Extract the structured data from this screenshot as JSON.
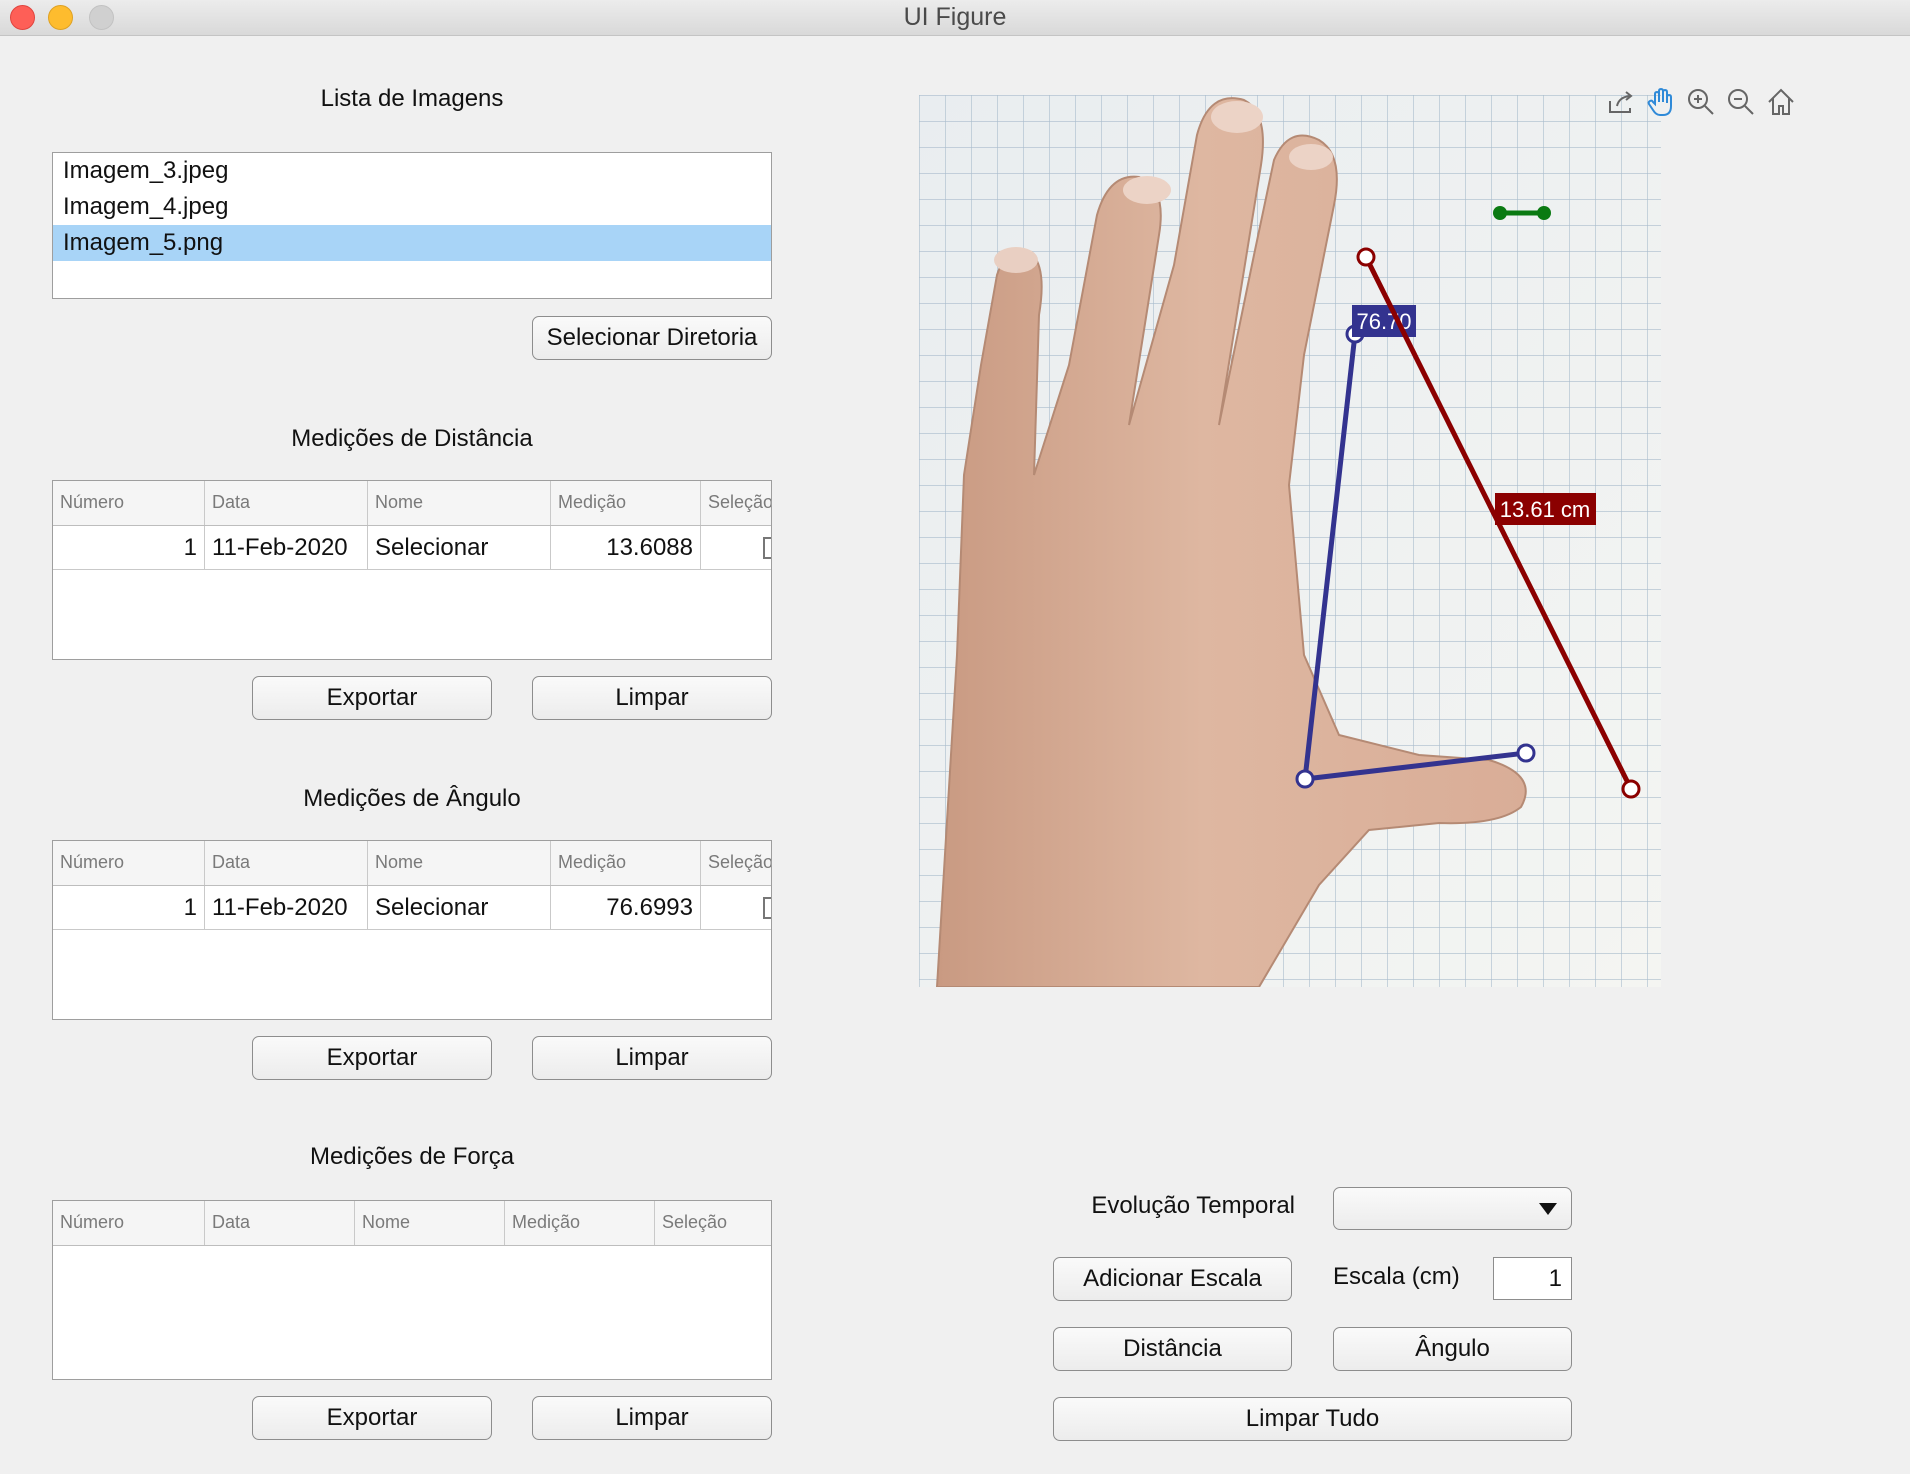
{
  "window": {
    "title": "UI Figure"
  },
  "images_panel": {
    "title": "Lista de Imagens",
    "items": [
      "Imagem_3.jpeg",
      "Imagem_4.jpeg",
      "Imagem_5.png"
    ],
    "selected": "Imagem_5.png",
    "select_dir_label": "Selecionar Diretoria"
  },
  "distance_table": {
    "title": "Medições de Distância",
    "headers": [
      "Número",
      "Data",
      "Nome",
      "Medição",
      "Seleção"
    ],
    "rows": [
      {
        "numero": "1",
        "data": "11-Feb-2020",
        "nome": "Selecionar",
        "medicao": "13.6088",
        "selecao": false
      }
    ],
    "export_label": "Exportar",
    "clear_label": "Limpar"
  },
  "angle_table": {
    "title": "Medições de Ângulo",
    "headers": [
      "Número",
      "Data",
      "Nome",
      "Medição",
      "Seleção"
    ],
    "rows": [
      {
        "numero": "1",
        "data": "11-Feb-2020",
        "nome": "Selecionar",
        "medicao": "76.6993",
        "selecao": false
      }
    ],
    "export_label": "Exportar",
    "clear_label": "Limpar"
  },
  "force_table": {
    "title": "Medições de Força",
    "headers": [
      "Número",
      "Data",
      "Nome",
      "Medição",
      "Seleção"
    ],
    "rows": [],
    "export_label": "Exportar",
    "clear_label": "Limpar"
  },
  "image_view": {
    "angle_label": "76.70",
    "distance_label": "13.61 cm",
    "colors": {
      "distance": "#8b0000",
      "angle": "#33338f",
      "scale": "#0a7a12"
    },
    "toolbar_icons": [
      "export-icon",
      "pan-hand-icon",
      "zoom-in-icon",
      "zoom-out-icon",
      "home-icon"
    ]
  },
  "controls": {
    "evolution_label": "Evolução Temporal",
    "evolution_value": "",
    "add_scale_label": "Adicionar Escala",
    "scale_label": "Escala (cm)",
    "scale_value": "1",
    "distance_label": "Distância",
    "angle_label": "Ângulo",
    "clear_all_label": "Limpar Tudo"
  }
}
